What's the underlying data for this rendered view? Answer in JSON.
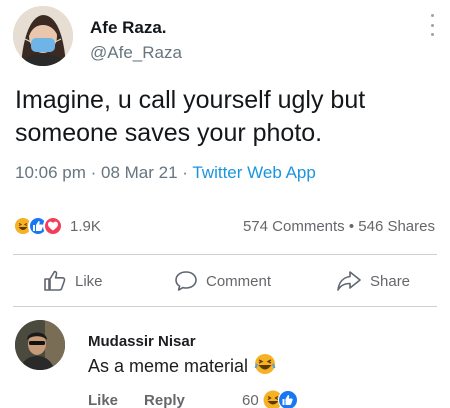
{
  "tweet": {
    "author_name": "Afe Raza.",
    "author_handle": "@Afe_Raza",
    "text": "Imagine, u call yourself ugly but someone saves your photo.",
    "time": "10:06 pm",
    "date": "08 Mar 21",
    "separator": " · ",
    "app": "Twitter Web App"
  },
  "post": {
    "reaction_count": "1.9K",
    "comments": "574 Comments",
    "shares": "546 Shares",
    "engagement_separator": " • ",
    "reaction_icons": [
      "laugh-icon",
      "like-icon",
      "love-icon"
    ]
  },
  "actions": {
    "like_label": "Like",
    "comment_label": "Comment",
    "share_label": "Share"
  },
  "comment": {
    "name": "Mudassir Nisar",
    "text": "As a meme material",
    "like_label": "Like",
    "reply_label": "Reply",
    "reaction_count": "60"
  },
  "colors": {
    "facebook_blue": "#1877f2",
    "love_red": "#f33e58",
    "haha_yellow": "#f7b125",
    "twitter_blue": "#1b95e0"
  }
}
